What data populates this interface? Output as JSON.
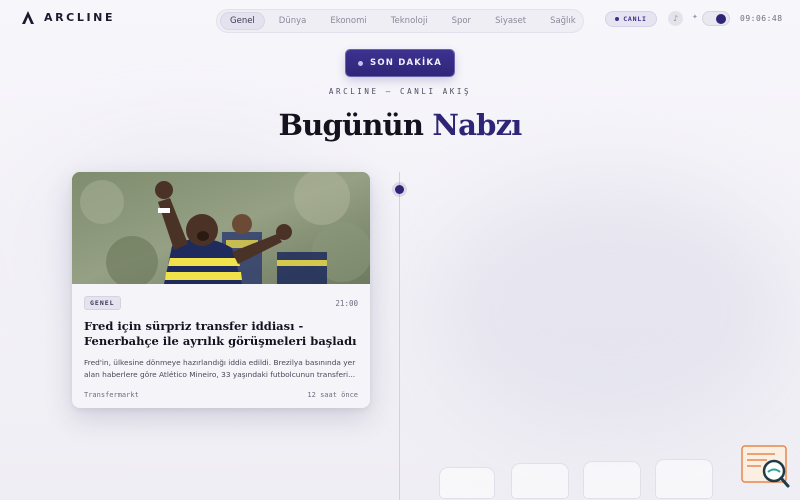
{
  "brand": {
    "name": "ARCLINE"
  },
  "nav": {
    "items": [
      {
        "label": "Genel",
        "active": true
      },
      {
        "label": "Dünya",
        "active": false
      },
      {
        "label": "Ekonomi",
        "active": false
      },
      {
        "label": "Teknoloji",
        "active": false
      },
      {
        "label": "Spor",
        "active": false
      },
      {
        "label": "Siyaset",
        "active": false
      },
      {
        "label": "Sağlık",
        "active": false
      }
    ]
  },
  "status": {
    "live_label": "CANLI",
    "music_glyph": "♪",
    "sparkle_glyph": "✦",
    "clock": "09:06:48"
  },
  "hero": {
    "breaking_label": "SON DAKİKA",
    "kicker": "ARCLINE — CANLI AKIŞ",
    "headline_main": "Bugünün ",
    "headline_accent": "Nabzı"
  },
  "article": {
    "category": "GENEL",
    "time": "21:00",
    "title": "Fred için sürpriz transfer iddiası - Fenerbahçe ile ayrılık görüşmeleri başladı",
    "excerpt": "Fred'in, ülkesine dönmeye hazırlandığı iddia edildi. Brezilya basınında yer alan haberlere göre Atlético Mineiro, 33 yaşındaki futbolcunun transferi...",
    "source": "Transfermarkt",
    "ago": "12 saat önce"
  },
  "colors": {
    "accent": "#2e2577",
    "background": "#f4f3f8",
    "text": "#14121f"
  },
  "icons": [
    "logo-icon",
    "music-icon",
    "sparkle-icon",
    "search-widget-icon"
  ]
}
